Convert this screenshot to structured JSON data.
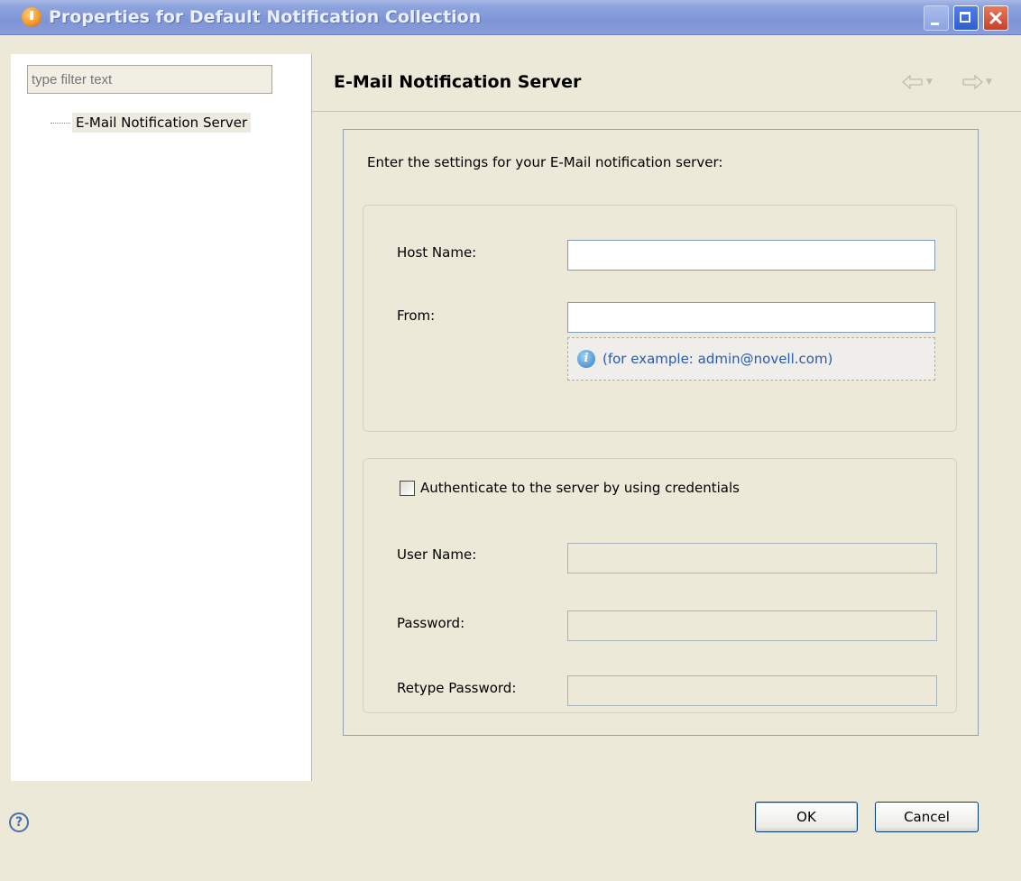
{
  "window": {
    "title": "Properties for Default Notification Collection"
  },
  "left_pane": {
    "filter_placeholder": "type filter text",
    "tree_items": [
      {
        "label": "E-Mail Notification Server",
        "selected": true
      }
    ]
  },
  "page": {
    "title": "E-Mail Notification Server",
    "intro": "Enter the settings for your E-Mail notification server:",
    "server_group": {
      "host_label": "Host Name:",
      "host_value": "",
      "from_label": "From:",
      "from_value": "",
      "from_hint": "(for example: admin@novell.com)"
    },
    "auth_group": {
      "checkbox_label": "Authenticate to the server by using credentials",
      "checkbox_checked": false,
      "user_label": "User Name:",
      "password_label": "Password:",
      "retype_label": "Retype Password:"
    }
  },
  "footer": {
    "ok_label": "OK",
    "cancel_label": "Cancel"
  },
  "icons": {
    "app": "app-icon",
    "back": "arrow-left-icon",
    "forward": "arrow-right-icon",
    "info": "info-icon",
    "help": "help-icon"
  },
  "colors": {
    "titlebar": "#7E95D6",
    "dialog_bg": "#ECE9D8",
    "close_button": "#C8402A",
    "hint_text": "#2B5BA8"
  }
}
